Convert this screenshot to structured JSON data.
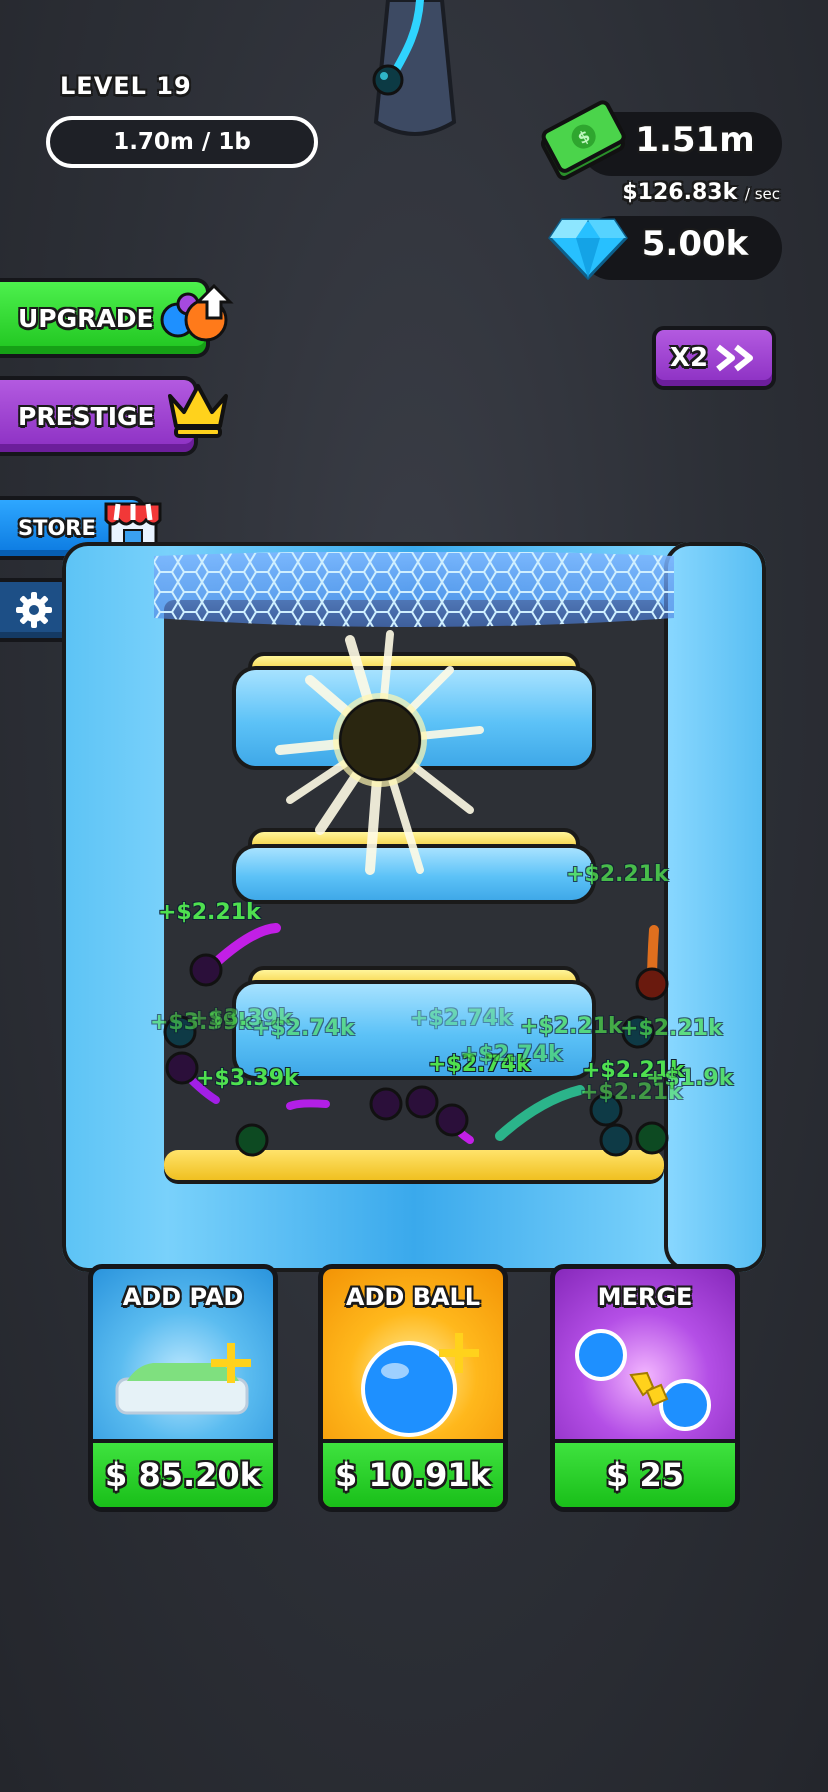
{
  "hud": {
    "level_label": "LEVEL 19",
    "level_progress": "1.70m / 1b",
    "cash_value": "1.51m",
    "cash_rate": "$126.83k",
    "cash_rate_unit": "/ sec",
    "gems_value": "5.00k"
  },
  "side_menu": {
    "upgrade_label": "UPGRADE",
    "prestige_label": "PRESTIGE",
    "store_label": "STORE"
  },
  "speed_button": {
    "label": "X2"
  },
  "floating_texts": [
    "+$2.21k",
    "+$2.21k",
    "+$3.39k",
    "+$2.74k",
    "+$2.21k",
    "+$2.74k",
    "+$2.21k",
    "+$2.21k",
    "+$3.39k",
    "+$2.74k",
    "+$1.9k",
    "+$2.21k",
    "+$3.39k",
    "+$2.74k"
  ],
  "shop": {
    "add_pad": {
      "title": "ADD PAD",
      "price": "$ 85.20k"
    },
    "add_ball": {
      "title": "ADD BALL",
      "price": "$ 10.91k"
    },
    "merge": {
      "title": "MERGE",
      "price": "$ 25"
    }
  },
  "colors": {
    "upgrade_green": "#1fc41f",
    "prestige_purple": "#8b2fc2",
    "store_blue": "#0b79e0",
    "board_blue": "#5cc3f5",
    "money_green": "#4fe04f",
    "price_green": "#19bf19"
  },
  "icons": [
    "cash-icon",
    "gem-icon",
    "upgrade-balls-icon",
    "crown-icon",
    "store-icon",
    "gear-icon",
    "fast-forward-icon",
    "pad-plus-icon",
    "ball-plus-icon",
    "merge-balls-icon"
  ]
}
